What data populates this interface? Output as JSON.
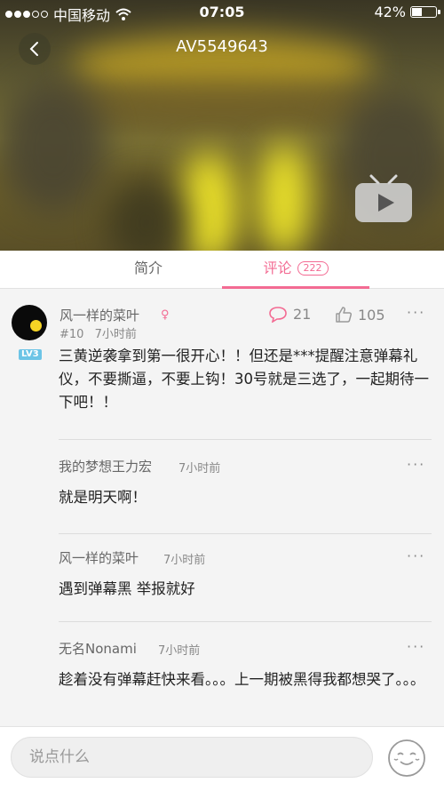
{
  "status_bar": {
    "carrier": "中国移动",
    "time": "07:05",
    "battery": "42%"
  },
  "header": {
    "title": "AV5549643"
  },
  "tabs": [
    {
      "label": "简介",
      "active": false
    },
    {
      "label": "评论",
      "active": true,
      "badge": "222"
    }
  ],
  "comment": {
    "user": "风一样的菜叶",
    "level_badge": "LV3",
    "floor": "#10",
    "time": "7小时前",
    "reply_count": "21",
    "like_count": "105",
    "text": "三黄逆袭拿到第一很开心！！但还是***提醒注意弹幕礼仪，不要撕逼，不要上钩！30号就是三选了，一起期待一下吧！！",
    "replies": [
      {
        "user": "我的梦想王力宏",
        "time": "7小时前",
        "text": "就是明天啊！"
      },
      {
        "user": "风一样的菜叶",
        "time": "7小时前",
        "text": "遇到弹幕黑 举报就好"
      },
      {
        "user": "无名Nonami",
        "time": "7小时前",
        "text": "趁着没有弹幕赶快来看。。。上一期被黑得我都想哭了。。。"
      }
    ]
  },
  "input": {
    "placeholder": "说点什么"
  },
  "colors": {
    "accent": "#f36b93",
    "level": "#6cc4e6"
  }
}
